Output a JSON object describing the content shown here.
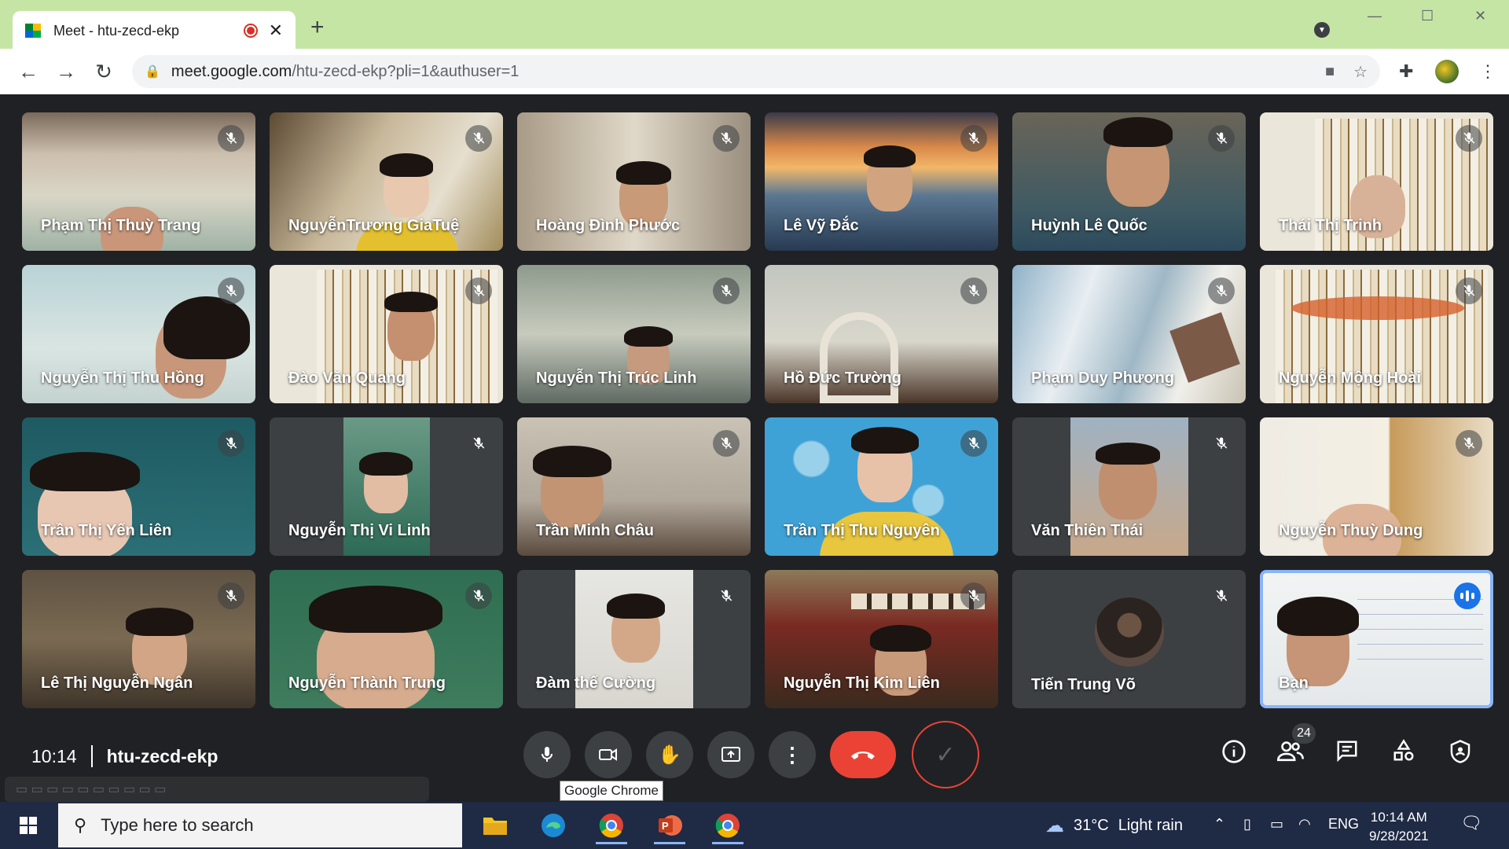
{
  "browser": {
    "tab_title": "Meet - htu-zecd-ekp",
    "url_host": "meet.google.com",
    "url_path": "/htu-zecd-ekp?pli=1&authuser=1",
    "new_tab_label": "+"
  },
  "participants": [
    {
      "name": "Phạm Thị Thuỳ Trang"
    },
    {
      "name": "NguyễnTrương GiaTuệ"
    },
    {
      "name": "Hoàng Đình Phước"
    },
    {
      "name": "Lê Vỹ Đắc"
    },
    {
      "name": "Huỳnh Lê Quốc"
    },
    {
      "name": "Thái Thị Trinh"
    },
    {
      "name": "Nguyễn Thị Thu Hồng"
    },
    {
      "name": "Đào Văn Quang"
    },
    {
      "name": "Nguyễn Thị Trúc Linh"
    },
    {
      "name": "Hồ Đức Trường"
    },
    {
      "name": "Phạm Duy Phương"
    },
    {
      "name": "Nguyễn Mộng Hoài"
    },
    {
      "name": "Trần Thị Yến Liên"
    },
    {
      "name": "Nguyễn Thị Vi Linh"
    },
    {
      "name": "Trần Minh Châu"
    },
    {
      "name": "Trần Thị Thu Nguyên"
    },
    {
      "name": "Văn Thiên Thái"
    },
    {
      "name": "Nguyễn Thuỳ Dung"
    },
    {
      "name": "Lê Thị Nguyễn Ngân"
    },
    {
      "name": "Nguyễn Thành Trung"
    },
    {
      "name": "Đàm thế Cường"
    },
    {
      "name": "Nguyễn Thị Kim Liên"
    },
    {
      "name": "Tiến Trung Võ"
    },
    {
      "name": "Bạn"
    }
  ],
  "meeting": {
    "time": "10:14",
    "code": "htu-zecd-ekp",
    "participant_count": "24",
    "tooltip": "Google Chrome"
  },
  "taskbar": {
    "search_placeholder": "Type here to search",
    "temperature": "31°C",
    "weather": "Light rain",
    "language": "ENG",
    "clock_time": "10:14 AM",
    "clock_date": "9/28/2021"
  },
  "colors": {
    "meet_bg": "#202124",
    "tile_bg": "#3c4043",
    "hangup": "#ea4335",
    "active_speaker": "#8ab4f8",
    "titlebar": "#c5e5a5",
    "taskbar": "#1f2a44"
  },
  "icons": {
    "mic": "microphone-icon",
    "camera": "camera-icon",
    "hand": "raise-hand-icon",
    "present": "present-icon",
    "more": "more-vert-icon",
    "hangup": "hangup-icon",
    "info": "info-icon",
    "people": "people-icon",
    "chat": "chat-icon",
    "activities": "activities-icon",
    "host": "host-controls-icon"
  }
}
